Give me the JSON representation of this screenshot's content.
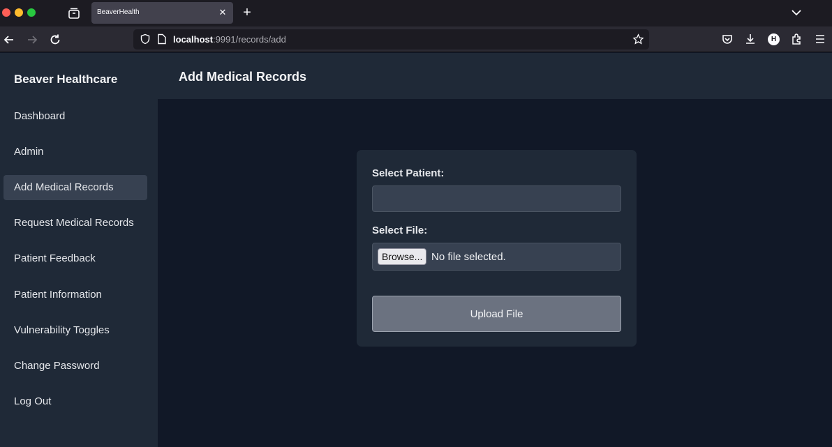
{
  "browser": {
    "tab_title": "BeaverHealth",
    "tab_close": "✕",
    "new_tab": "+",
    "url_host": "localhost",
    "url_rest": ":9991/records/add",
    "profile_initial": "H"
  },
  "sidebar": {
    "brand": "Beaver Healthcare",
    "items": [
      {
        "label": "Dashboard"
      },
      {
        "label": "Admin"
      },
      {
        "label": "Add Medical Records"
      },
      {
        "label": "Request Medical Records"
      },
      {
        "label": "Patient Feedback"
      },
      {
        "label": "Patient Information"
      },
      {
        "label": "Vulnerability Toggles"
      },
      {
        "label": "Change Password"
      },
      {
        "label": "Log Out"
      }
    ],
    "active_index": 2
  },
  "header": {
    "title": "Add Medical Records"
  },
  "form": {
    "patient_label": "Select Patient:",
    "patient_value": "",
    "file_label": "Select File:",
    "browse_label": "Browse...",
    "file_status": "No file selected.",
    "upload_label": "Upload File"
  },
  "colors": {
    "page_bg": "#111827",
    "panel_bg": "#1f2937",
    "active_item": "#374151",
    "button_bg": "#6b7280"
  }
}
